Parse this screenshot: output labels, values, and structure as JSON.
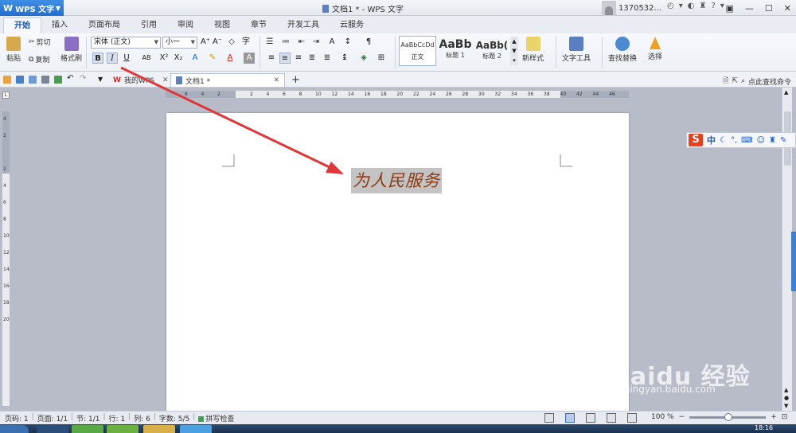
{
  "titlebar": {
    "app_name": "WPS 文字",
    "doc_title": "文档1 * - WPS 文字",
    "user_name": "1370532...",
    "icons": [
      "clock-icon",
      "skin-icon",
      "shirt-icon",
      "help-icon",
      "menu-icon"
    ]
  },
  "tabs": [
    "开始",
    "插入",
    "页面布局",
    "引用",
    "审阅",
    "视图",
    "章节",
    "开发工具",
    "云服务"
  ],
  "ribbon": {
    "cut": "剪切",
    "paste": "粘贴",
    "copy": "复制",
    "format_painter": "格式刷",
    "font_name": "宋体 (正文)",
    "font_size": "小一",
    "styles": [
      {
        "sample": "AaBbCcDd",
        "label": "正文"
      },
      {
        "sample": "AaBb",
        "label": "标题 1"
      },
      {
        "sample": "AaBb(",
        "label": "标题 2"
      }
    ],
    "new_style": "新样式",
    "text_tools": "文字工具",
    "find_replace": "查找替换",
    "select": "选择"
  },
  "quickbar": {
    "tabs": [
      {
        "label": "我的WPS"
      },
      {
        "label": "文档1 *"
      }
    ],
    "search_cmd": "点此查找命令"
  },
  "ruler": {
    "h_numbers": [
      "6",
      "4",
      "2",
      "",
      "2",
      "4",
      "6",
      "8",
      "10",
      "12",
      "14",
      "16",
      "18",
      "20",
      "22",
      "24",
      "26",
      "28",
      "30",
      "32",
      "34",
      "36",
      "38",
      "40",
      "42",
      "44",
      "46"
    ],
    "v_numbers": [
      "4",
      "2",
      "",
      "2",
      "4",
      "6",
      "8",
      "10",
      "12",
      "14",
      "16",
      "18",
      "20"
    ]
  },
  "document": {
    "text": "为人民服务"
  },
  "ime": {
    "lang": "中"
  },
  "status": {
    "page_code": "页码: 1",
    "pages": "页面: 1/1",
    "section": "节: 1/1",
    "row": "行: 1",
    "col": "列: 6",
    "words": "字数: 5/5",
    "spell": "拼写检查",
    "zoom": "100 %"
  },
  "taskbar": {
    "time": "18:16"
  },
  "watermark": {
    "brand": "Baidu 经验",
    "url": "jingyan.baidu.com"
  }
}
